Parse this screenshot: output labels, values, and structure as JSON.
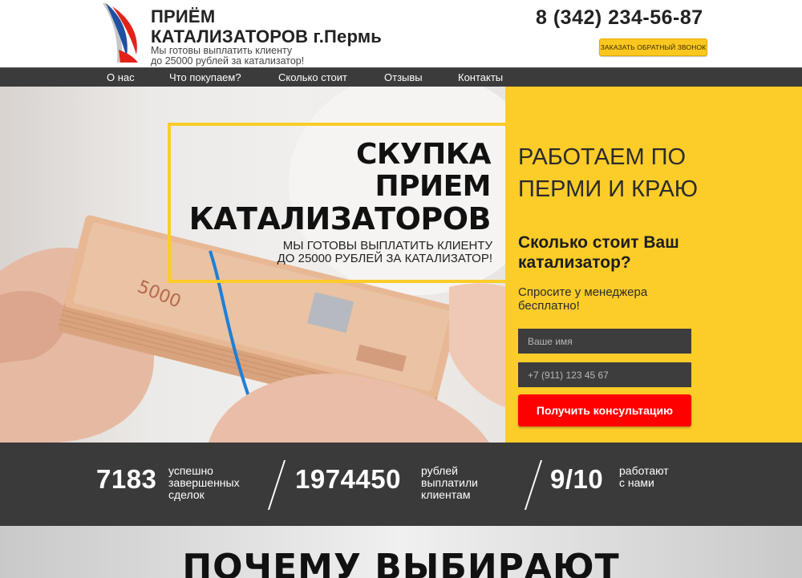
{
  "header": {
    "logo_title_line1": "ПРИЁМ",
    "logo_title_line2": "КАТАЛИЗАТОРОВ г.Пермь",
    "logo_sub_line1": "Мы готовы выплатить клиенту",
    "logo_sub_line2": "до 25000 рублей за катализатор!",
    "phone": "8 (342) 234-56-87",
    "callback_label": "ЗАКАЗАТЬ ОБРАТНЫЙ ЗВОНОК"
  },
  "nav": {
    "items": [
      {
        "label": "О нас"
      },
      {
        "label": "Что покупаем?"
      },
      {
        "label": "Сколько стоит"
      },
      {
        "label": "Отзывы"
      },
      {
        "label": "Контакты"
      }
    ]
  },
  "hero": {
    "title_line1": "СКУПКА",
    "title_line2": "ПРИЕМ",
    "title_line3": "КАТАЛИЗАТОРОВ",
    "sub_line1": "МЫ ГОТОВЫ ВЫПЛАТИТЬ КЛИЕНТУ",
    "sub_line2": "ДО 25000 РУБЛЕЙ ЗА КАТАЛИЗАТОР!",
    "banknote_text": "5000",
    "work_line1": "РАБОТАЕМ ПО",
    "work_line2": "ПЕРМИ И КРАЮ",
    "price_line1": "Сколько стоит Ваш",
    "price_line2": "катализатор?",
    "ask_line1": "Спросите у менеджера",
    "ask_line2": "бесплатно!",
    "name_placeholder": "Ваше имя",
    "phone_placeholder": "+7 (911) 123 45 67",
    "consult_label": "Получить консультацию"
  },
  "stats": [
    {
      "value": "7183",
      "label_line1": "успешно",
      "label_line2": "завершенных",
      "label_line3": "сделок"
    },
    {
      "value": "1974450",
      "label_line1": "рублей",
      "label_line2": "выплатили",
      "label_line3": "клиентам"
    },
    {
      "value": "9/10",
      "label_line1": "работают",
      "label_line2": "с нами",
      "label_line3": ""
    }
  ],
  "why": {
    "title": "ПОЧЕМУ ВЫБИРАЮТ"
  },
  "colors": {
    "accent_yellow": "#fccc29",
    "button_red": "#fe0000",
    "dark_bar": "#3a3a3a",
    "logo_blue": "#1f4fa0",
    "logo_red": "#e2231a"
  }
}
